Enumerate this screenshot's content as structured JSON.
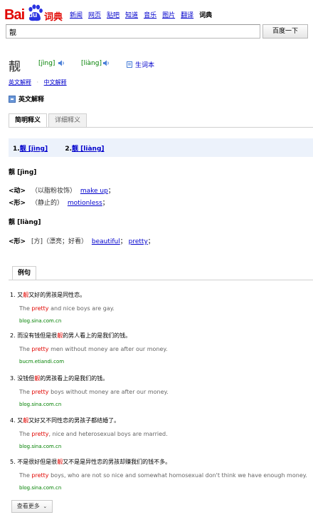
{
  "header": {
    "logo_text": "Bai",
    "logo_du": "du",
    "logo_product": "词典",
    "nav": [
      {
        "label": "新闻",
        "current": false
      },
      {
        "label": "网页",
        "current": false
      },
      {
        "label": "贴吧",
        "current": false
      },
      {
        "label": "知道",
        "current": false
      },
      {
        "label": "音乐",
        "current": false
      },
      {
        "label": "图片",
        "current": false
      },
      {
        "label": "翻译",
        "current": false
      },
      {
        "label": "词典",
        "current": true
      }
    ],
    "search_value": "靓",
    "search_button": "百度一下"
  },
  "headword": {
    "word": "靓",
    "pron1": "[jìng]",
    "pron2": "[liàng]",
    "vocab_label": "生词本",
    "icons": {
      "speaker": "speaker-icon",
      "vocab": "vocab-book-icon",
      "collapse": "minus-icon"
    }
  },
  "links": {
    "english_def": "英文解释",
    "separator": "·",
    "chinese_def": "中文解释"
  },
  "section_title": "英文解释",
  "tabs": [
    {
      "label": "简明释义",
      "active": true
    },
    {
      "label": "详细释义",
      "active": false
    }
  ],
  "senses": {
    "n1": "1.",
    "w1": "靓 [jìng]",
    "n2": "2.",
    "w2": "靓 [liàng]"
  },
  "entries": [
    {
      "heading": "靓 [jìng]",
      "defs": [
        {
          "pos": "<动>",
          "zh": "（以脂粉妆饰）",
          "en": [
            "make up"
          ],
          "sep": "；"
        },
        {
          "pos": "<形>",
          "zh": "（静止的）",
          "en": [
            "motionless"
          ],
          "sep": "；"
        }
      ]
    },
    {
      "heading": "靓 [liàng]",
      "defs": [
        {
          "pos": "<形>",
          "zh": "[方]（漂亮；好看）",
          "en": [
            "beautiful",
            "pretty"
          ],
          "sep": "；"
        }
      ]
    }
  ],
  "examples_tab": "例句",
  "examples": [
    {
      "num": "1.",
      "cn_pre": "又",
      "cn_hl": "靓",
      "cn_post": "又好的男孩是同性恋。",
      "en_pre": "The ",
      "en_hl": "pretty",
      "en_post": " and nice boys are gay.",
      "source": "blog.sina.com.cn"
    },
    {
      "num": "2.",
      "cn_pre": "而没有钱但是很",
      "cn_hl": "靓",
      "cn_post": "的男人看上的是我们的钱。",
      "en_pre": "The ",
      "en_hl": "pretty",
      "en_post": " men without money are after our money.",
      "source": "bucm.etiandi.com"
    },
    {
      "num": "3.",
      "cn_pre": "没钱但",
      "cn_hl": "靓",
      "cn_post": "的男孩看上的是我们的钱。",
      "en_pre": "The ",
      "en_hl": "pretty",
      "en_post": " boys without money are after our money.",
      "source": "blog.sina.com.cn"
    },
    {
      "num": "4.",
      "cn_pre": "又",
      "cn_hl": "靓",
      "cn_post": "又好又不同性恋的男孩子都结婚了。",
      "en_pre": "The ",
      "en_hl": "pretty",
      "en_post": ", nice and heterosexual boys are married.",
      "source": "blog.sina.com.cn"
    },
    {
      "num": "5.",
      "cn_pre": "不是很好但是很",
      "cn_hl": "靓",
      "cn_post": "又不是是异性恋的男孩却赚我们的钱不多。",
      "en_pre": "The ",
      "en_hl": "pretty",
      "en_post": " boys, who are not so nice and somewhat homosexual don't think we have enough money.",
      "source": "blog.sina.com.cn"
    }
  ],
  "more_button": "查看更多"
}
